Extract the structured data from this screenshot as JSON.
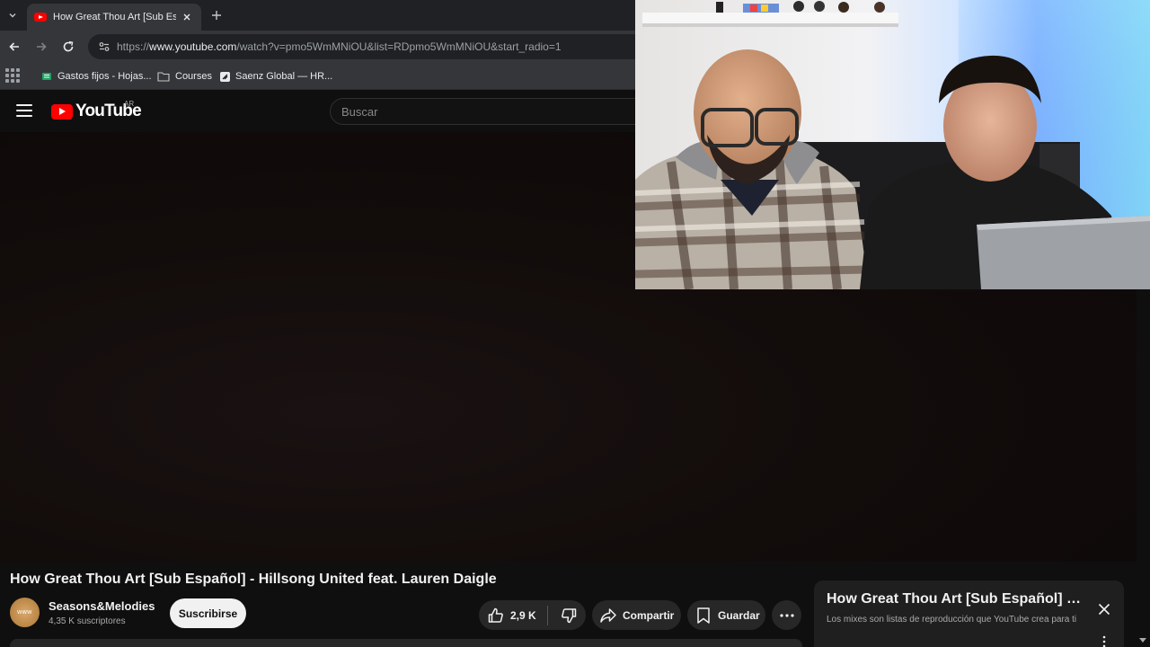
{
  "browser": {
    "tab": {
      "title": "How Great Thou Art [Sub Español] - Hillsong United feat. Lauren Daigle - YouTube"
    },
    "address": {
      "prefix": "https://",
      "domain": "www.youtube.com",
      "path": "/watch?v=pmo5WmMNiOU&list=RDpmo5WmMNiOU&start_radio=1"
    },
    "bookmarks": [
      {
        "label": "Gastos fijos - Hojas..."
      },
      {
        "label": "Courses"
      },
      {
        "label": "Saenz Global — HR..."
      }
    ]
  },
  "youtube": {
    "logo_text": "YouTube",
    "country_code": "AR",
    "search_placeholder": "Buscar"
  },
  "video": {
    "title": "How Great Thou Art [Sub Español] - Hillsong United feat. Lauren Daigle",
    "channel": {
      "name": "Seasons&Melodies",
      "subscribers": "4,35 K suscriptores",
      "avatar_text": "www"
    },
    "subscribe_label": "Suscribirse",
    "likes": "2,9 K",
    "share_label": "Compartir",
    "save_label": "Guardar"
  },
  "mix": {
    "title": "How Great Thou Art [Sub Español] - Hillsong United feat. Lauren Daigle",
    "subtitle": "Los mixes son listas de reproducción que YouTube crea para ti"
  },
  "colors": {
    "brand_red": "#ff0000",
    "background": "#0f0f0f",
    "pill": "#272727"
  },
  "icons": [
    "tab-search-icon",
    "youtube-favicon-icon",
    "close-icon",
    "plus-icon",
    "back-arrow-icon",
    "forward-arrow-icon",
    "reload-icon",
    "site-info-icon",
    "apps-grid-icon",
    "sheets-icon",
    "folder-icon",
    "saenz-icon",
    "hamburger-icon",
    "like-icon",
    "dislike-icon",
    "share-icon",
    "save-icon",
    "more-icon",
    "kebab-icon"
  ]
}
